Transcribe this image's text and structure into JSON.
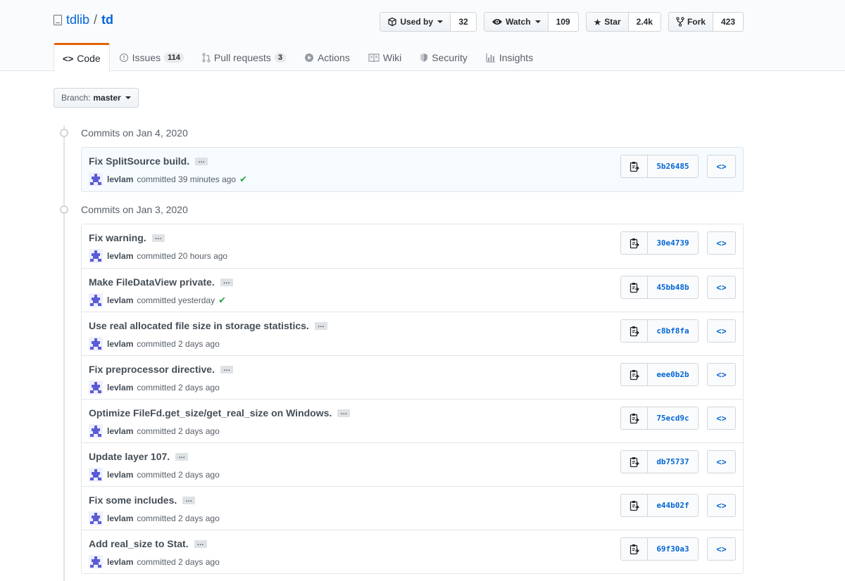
{
  "repo": {
    "owner": "tdlib",
    "separator": "/",
    "name": "td"
  },
  "actions": [
    {
      "label": "Used by",
      "icon": "package-icon",
      "count": "32",
      "dropdown": true
    },
    {
      "label": "Watch",
      "icon": "eye-icon",
      "count": "109",
      "dropdown": true
    },
    {
      "label": "Star",
      "icon": "star-icon",
      "count": "2.4k",
      "dropdown": false
    },
    {
      "label": "Fork",
      "icon": "fork-icon",
      "count": "423",
      "dropdown": false
    }
  ],
  "nav": [
    {
      "label": "Code",
      "icon": "code-icon",
      "counter": "",
      "selected": true
    },
    {
      "label": "Issues",
      "icon": "issue-icon",
      "counter": "114",
      "selected": false
    },
    {
      "label": "Pull requests",
      "icon": "pull-request-icon",
      "counter": "3",
      "selected": false
    },
    {
      "label": "Actions",
      "icon": "play-icon",
      "counter": "",
      "selected": false
    },
    {
      "label": "Wiki",
      "icon": "book-icon",
      "counter": "",
      "selected": false
    },
    {
      "label": "Security",
      "icon": "shield-icon",
      "counter": "",
      "selected": false
    },
    {
      "label": "Insights",
      "icon": "graph-icon",
      "counter": "",
      "selected": false
    }
  ],
  "branch": {
    "prefix": "Branch:",
    "name": "master"
  },
  "groups": [
    {
      "title": "Commits on Jan 4, 2020",
      "commits": [
        {
          "message": "Fix SplitSource build.",
          "author": "levlam",
          "time": "committed 39 minutes ago",
          "verified": true,
          "sha": "5b26485",
          "highlighted": true
        }
      ]
    },
    {
      "title": "Commits on Jan 3, 2020",
      "commits": [
        {
          "message": "Fix warning.",
          "author": "levlam",
          "time": "committed 20 hours ago",
          "verified": false,
          "sha": "30e4739",
          "highlighted": false
        },
        {
          "message": "Make FileDataView private.",
          "author": "levlam",
          "time": "committed yesterday",
          "verified": true,
          "sha": "45bb48b",
          "highlighted": false
        },
        {
          "message": "Use real allocated file size in storage statistics.",
          "author": "levlam",
          "time": "committed 2 days ago",
          "verified": false,
          "sha": "c8bf8fa",
          "highlighted": false
        },
        {
          "message": "Fix preprocessor directive.",
          "author": "levlam",
          "time": "committed 2 days ago",
          "verified": false,
          "sha": "eee0b2b",
          "highlighted": false
        },
        {
          "message": "Optimize FileFd.get_size/get_real_size on Windows.",
          "author": "levlam",
          "time": "committed 2 days ago",
          "verified": false,
          "sha": "75ecd9c",
          "highlighted": false
        },
        {
          "message": "Update layer 107.",
          "author": "levlam",
          "time": "committed 2 days ago",
          "verified": false,
          "sha": "db75737",
          "highlighted": false
        },
        {
          "message": "Fix some includes.",
          "author": "levlam",
          "time": "committed 2 days ago",
          "verified": false,
          "sha": "e44b02f",
          "highlighted": false
        },
        {
          "message": "Add real_size to Stat.",
          "author": "levlam",
          "time": "committed 2 days ago",
          "verified": false,
          "sha": "69f30a3",
          "highlighted": false
        }
      ]
    }
  ],
  "colors": {
    "link": "#0366d6",
    "accent": "#e36209",
    "success": "#28a745",
    "avatar": "#5b5bd6"
  }
}
